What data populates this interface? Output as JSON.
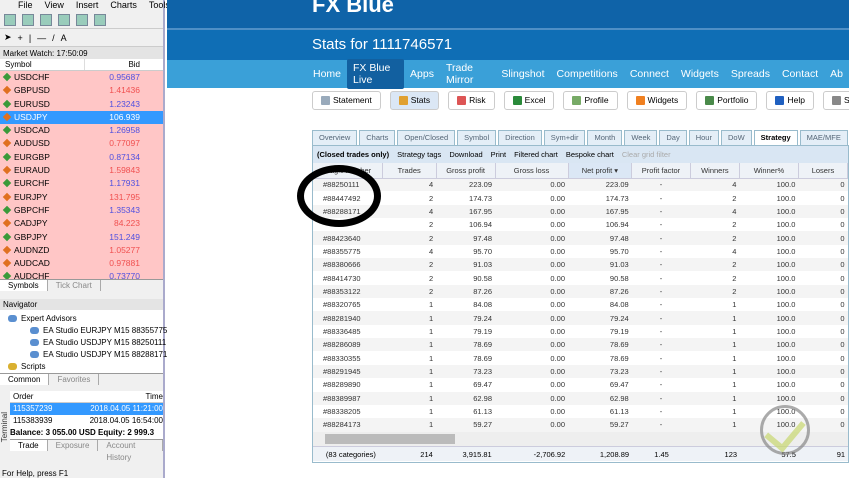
{
  "menu": [
    "File",
    "View",
    "Insert",
    "Charts",
    "Tools"
  ],
  "market_watch": {
    "title": "Market Watch: 17:50:09",
    "col_symbol": "Symbol",
    "col_bid": "Bid",
    "rows": [
      {
        "symbol": "USDCHF",
        "bid": "0.95687",
        "dir": "up"
      },
      {
        "symbol": "GBPUSD",
        "bid": "1.41436",
        "dir": "down"
      },
      {
        "symbol": "EURUSD",
        "bid": "1.23243",
        "dir": "up"
      },
      {
        "symbol": "USDJPY",
        "bid": "106.939",
        "dir": "down",
        "selected": true
      },
      {
        "symbol": "USDCAD",
        "bid": "1.26958",
        "dir": "up"
      },
      {
        "symbol": "AUDUSD",
        "bid": "0.77097",
        "dir": "down"
      },
      {
        "symbol": "EURGBP",
        "bid": "0.87134",
        "dir": "up"
      },
      {
        "symbol": "EURAUD",
        "bid": "1.59843",
        "dir": "down"
      },
      {
        "symbol": "EURCHF",
        "bid": "1.17931",
        "dir": "up"
      },
      {
        "symbol": "EURJPY",
        "bid": "131.795",
        "dir": "down"
      },
      {
        "symbol": "GBPCHF",
        "bid": "1.35343",
        "dir": "up"
      },
      {
        "symbol": "CADJPY",
        "bid": "84.223",
        "dir": "down"
      },
      {
        "symbol": "GBPJPY",
        "bid": "151.249",
        "dir": "up"
      },
      {
        "symbol": "AUDNZD",
        "bid": "1.05277",
        "dir": "down"
      },
      {
        "symbol": "AUDCAD",
        "bid": "0.97881",
        "dir": "down"
      },
      {
        "symbol": "AUDCHF",
        "bid": "0.73770",
        "dir": "up"
      }
    ],
    "tabs": [
      "Symbols",
      "Tick Chart"
    ]
  },
  "navigator": {
    "title": "Navigator",
    "items": [
      "Expert Advisors",
      "EA Studio EURJPY M15 88355775",
      "EA Studio USDJPY M15 88250111",
      "EA Studio USDJPY M15 88288171",
      "Scripts"
    ],
    "tabs": [
      "Common",
      "Favorites"
    ]
  },
  "terminal": {
    "label": "Terminal",
    "col_order": "Order",
    "col_time": "Time",
    "orders": [
      {
        "order": "115357239",
        "time": "2018.04.05 11:21:00"
      },
      {
        "order": "115383939",
        "time": "2018.04.05 16:54:00"
      }
    ],
    "balance": "Balance: 3 055.00 USD  Equity: 2 999.3",
    "tabs": [
      "Trade",
      "Exposure",
      "Account History"
    ]
  },
  "status_bar": "For Help, press F1",
  "site": {
    "logo": "FX Blue",
    "title": "Stats for 1111746571",
    "nav": [
      "Home",
      "FX Blue Live",
      "Apps",
      "Trade Mirror",
      "Slingshot",
      "Competitions",
      "Connect",
      "Widgets",
      "Spreads",
      "Contact",
      "Ab"
    ],
    "buttons": [
      {
        "label": "Statement",
        "color": "#9ab"
      },
      {
        "label": "Stats",
        "color": "#e0a030"
      },
      {
        "label": "Risk",
        "color": "#d55"
      },
      {
        "label": "Excel",
        "color": "#2a8a3a"
      },
      {
        "label": "Profile",
        "color": "#7a6"
      },
      {
        "label": "Widgets",
        "color": "#f08020"
      },
      {
        "label": "Portfolio",
        "color": "#4a8a4a"
      },
      {
        "label": "Help",
        "color": "#2060c0"
      },
      {
        "label": "S",
        "color": "#888"
      }
    ],
    "tabs": [
      "Overview",
      "Charts",
      "Open/Closed",
      "Symbol",
      "Direction",
      "Sym+dir",
      "Month",
      "Week",
      "Day",
      "Hour",
      "DoW",
      "Strategy",
      "MAE/MFE"
    ],
    "grid_toolbar": {
      "note": "(Closed trades only)",
      "items": [
        "Strategy tags",
        "Download",
        "Print",
        "Filtered chart",
        "Bespoke chart"
      ],
      "disabled": "Clear grid filter"
    },
    "columns": [
      "Magic number",
      "Trades",
      "Gross profit",
      "Gross loss",
      "Net profit ▾",
      "Profit factor",
      "Winners",
      "Winner%",
      "Losers"
    ],
    "rows": [
      [
        "#88250111",
        "4",
        "223.09",
        "0.00",
        "223.09",
        "-",
        "4",
        "100.0",
        "0"
      ],
      [
        "#88447492",
        "2",
        "174.73",
        "0.00",
        "174.73",
        "-",
        "2",
        "100.0",
        "0"
      ],
      [
        "#88288171",
        "4",
        "167.95",
        "0.00",
        "167.95",
        "-",
        "4",
        "100.0",
        "0"
      ],
      [
        "",
        "2",
        "106.94",
        "0.00",
        "106.94",
        "-",
        "2",
        "100.0",
        "0"
      ],
      [
        "#88423640",
        "2",
        "97.48",
        "0.00",
        "97.48",
        "-",
        "2",
        "100.0",
        "0"
      ],
      [
        "#88355775",
        "4",
        "95.70",
        "0.00",
        "95.70",
        "-",
        "4",
        "100.0",
        "0"
      ],
      [
        "#88380666",
        "2",
        "91.03",
        "0.00",
        "91.03",
        "-",
        "2",
        "100.0",
        "0"
      ],
      [
        "#88414730",
        "2",
        "90.58",
        "0.00",
        "90.58",
        "-",
        "2",
        "100.0",
        "0"
      ],
      [
        "#88353122",
        "2",
        "87.26",
        "0.00",
        "87.26",
        "-",
        "2",
        "100.0",
        "0"
      ],
      [
        "#88320765",
        "1",
        "84.08",
        "0.00",
        "84.08",
        "-",
        "1",
        "100.0",
        "0"
      ],
      [
        "#88281940",
        "1",
        "79.24",
        "0.00",
        "79.24",
        "-",
        "1",
        "100.0",
        "0"
      ],
      [
        "#88336485",
        "1",
        "79.19",
        "0.00",
        "79.19",
        "-",
        "1",
        "100.0",
        "0"
      ],
      [
        "#88286089",
        "1",
        "78.69",
        "0.00",
        "78.69",
        "-",
        "1",
        "100.0",
        "0"
      ],
      [
        "#88330355",
        "1",
        "78.69",
        "0.00",
        "78.69",
        "-",
        "1",
        "100.0",
        "0"
      ],
      [
        "#88291945",
        "1",
        "73.23",
        "0.00",
        "73.23",
        "-",
        "1",
        "100.0",
        "0"
      ],
      [
        "#88289890",
        "1",
        "69.47",
        "0.00",
        "69.47",
        "-",
        "1",
        "100.0",
        "0"
      ],
      [
        "#88389987",
        "1",
        "62.98",
        "0.00",
        "62.98",
        "-",
        "1",
        "100.0",
        "0"
      ],
      [
        "#88338205",
        "1",
        "61.13",
        "0.00",
        "61.13",
        "-",
        "1",
        "100.0",
        "0"
      ],
      [
        "#88284173",
        "1",
        "59.27",
        "0.00",
        "59.27",
        "-",
        "1",
        "100.0",
        "0"
      ]
    ],
    "footer": [
      "(83 categories)",
      "214",
      "3,915.81",
      "-2,706.92",
      "1,208.89",
      "1.45",
      "123",
      "57.5",
      "91"
    ]
  }
}
